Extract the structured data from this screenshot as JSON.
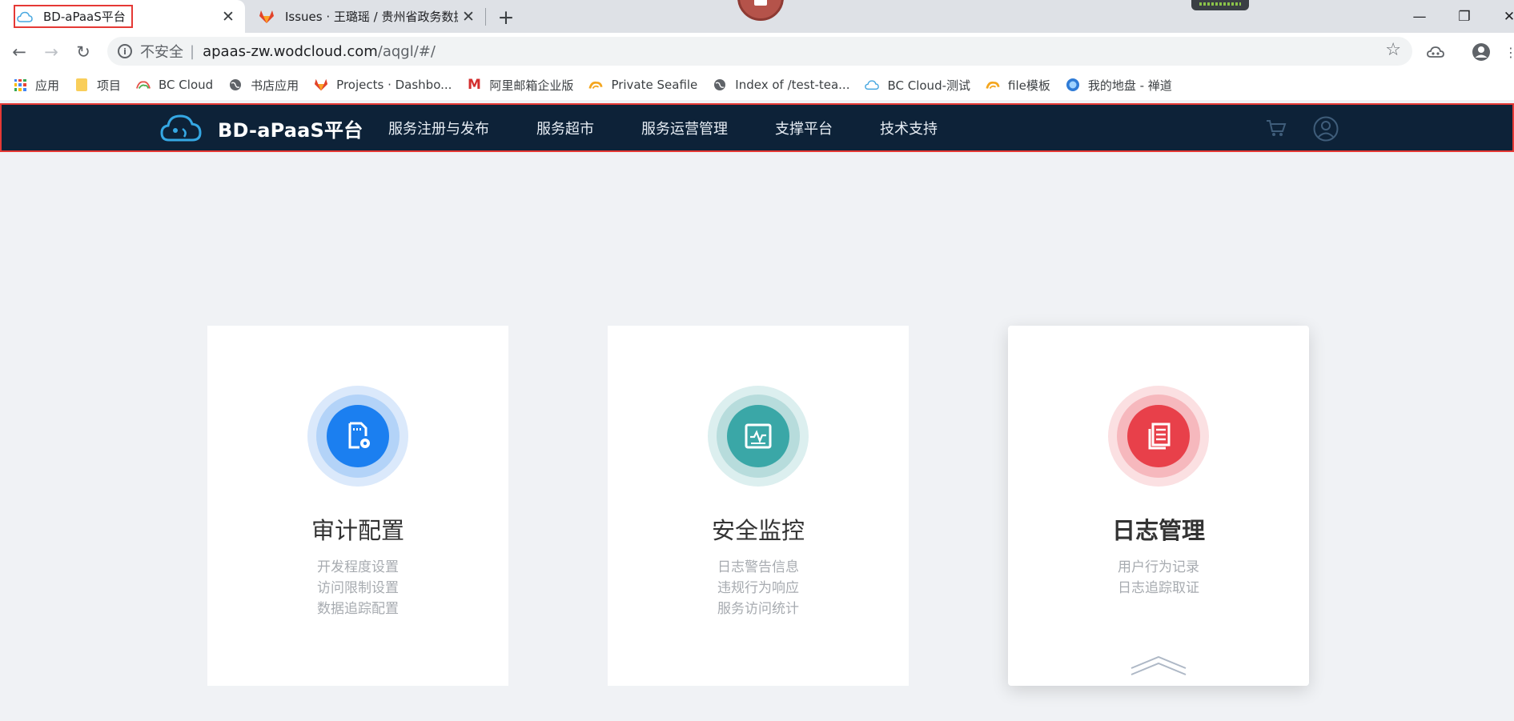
{
  "browser": {
    "tabs": [
      {
        "title": "BD-aPaaS平台",
        "active": true
      },
      {
        "title": "Issues · 王璐瑶 / 贵州省政务数据",
        "active": false
      }
    ],
    "url": {
      "security_label": "不安全",
      "host": "apaas-zw.wodcloud.com",
      "path": "/aqgl/#/"
    },
    "bookmarks": [
      {
        "label": "应用",
        "icon": "apps-grid-icon"
      },
      {
        "label": "项目",
        "icon": "folder-icon"
      },
      {
        "label": "BC Cloud",
        "icon": "bc-cloud-icon"
      },
      {
        "label": "书店应用",
        "icon": "globe-icon"
      },
      {
        "label": "Projects · Dashbo...",
        "icon": "gitlab-icon"
      },
      {
        "label": "阿里邮箱企业版",
        "icon": "mail-icon"
      },
      {
        "label": "Private Seafile",
        "icon": "seafile-icon"
      },
      {
        "label": "Index of /test-tea...",
        "icon": "globe-icon"
      },
      {
        "label": "BC Cloud-测试",
        "icon": "cloud-icon"
      },
      {
        "label": "file模板",
        "icon": "seafile-icon"
      },
      {
        "label": "我的地盘 - 禅道",
        "icon": "zentao-icon"
      }
    ]
  },
  "app": {
    "brand": "BD-aPaaS平台",
    "menu": [
      "服务注册与发布",
      "服务超市",
      "服务运营管理",
      "支撑平台",
      "技术支持"
    ]
  },
  "cards": [
    {
      "title": "审计配置",
      "items": [
        "开发程度设置",
        "访问限制设置",
        "数据追踪配置"
      ],
      "accent": "#1b7ff0"
    },
    {
      "title": "安全监控",
      "items": [
        "日志警告信息",
        "违规行为响应",
        "服务访问统计"
      ],
      "accent": "#3aa7a7"
    },
    {
      "title": "日志管理",
      "items": [
        "用户行为记录",
        "日志追踪取证"
      ],
      "accent": "#e8404a"
    }
  ],
  "colors": {
    "nav_bg": "#0d2238",
    "page_bg": "#f0f2f5",
    "highlight": "#e53935"
  }
}
